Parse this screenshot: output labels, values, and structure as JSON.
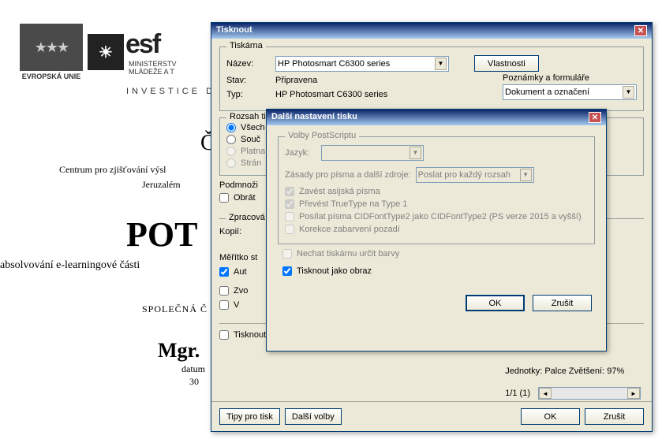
{
  "doc": {
    "eu_label": "EVROPSKÁ UNIE",
    "esf": "esf",
    "ministry1": "MINISTERSTV",
    "ministry2": "MLÁDEŽE A T",
    "invest": "INVESTICE DO",
    "c_letter": "Č",
    "centrum": "Centrum pro zjišťování výsl",
    "jeruzalem": "Jeruzalém",
    "pot": "POT",
    "absolv": "absolvování e-learningové části",
    "spolecna": "SPOLEČNÁ  Č",
    "mgr": "Mgr.",
    "datum": "datum",
    "thirty": "30"
  },
  "print": {
    "title": "Tisknout",
    "tiskarna_legend": "Tiskárna",
    "nazev_label": "Název:",
    "nazev_value": "HP Photosmart C6300 series",
    "vlastnosti": "Vlastnosti",
    "stav_label": "Stav:",
    "stav_value": "Připravena",
    "typ_label": "Typ:",
    "typ_value": "HP Photosmart C6300 series",
    "pozn_label": "Poznámky a formuláře",
    "pozn_value": "Dokument a označení",
    "rozsah_legend": "Rozsah tis",
    "vsech": "Všech",
    "souc": "Souč",
    "platna": "Platna",
    "stran": "Strán",
    "podmnoz": "Podmnoži",
    "obrat": "Obrát",
    "zprac_legend": "Zpracová",
    "kopii": "Kopií:",
    "meritko": "Měřítko st",
    "aut": "Aut",
    "zvo": "Zvo",
    "v": "V",
    "do_souboru": "Tisknout do souboru",
    "jednotky": "Jednotky: Palce Zvětšení:  97%",
    "pagepos": "1/1 (1)",
    "tipy": "Tipy pro tisk",
    "dalsi_volby": "Další volby",
    "ok": "OK",
    "zrusit": "Zrušit"
  },
  "adv": {
    "title": "Další nastavení tisku",
    "ps_legend": "Volby PostScriptu",
    "jazyk": "Jazyk:",
    "zasady": "Zásady pro písma a další zdroje:",
    "zasady_value": "Poslat pro každý rozsah",
    "zavest": "Zavést asijská písma",
    "prevest": "Převést TrueType na Type 1",
    "posilat": "Posílat písma CIDFontType2 jako CIDFontType2 (PS verze 2015 a vyšší)",
    "korekce": "Korekce zabarvení pozadí",
    "nechat": "Nechat tiskárnu určit barvy",
    "tisknout_obraz": "Tisknout jako obraz",
    "ok": "OK",
    "zrusit": "Zrušit"
  }
}
